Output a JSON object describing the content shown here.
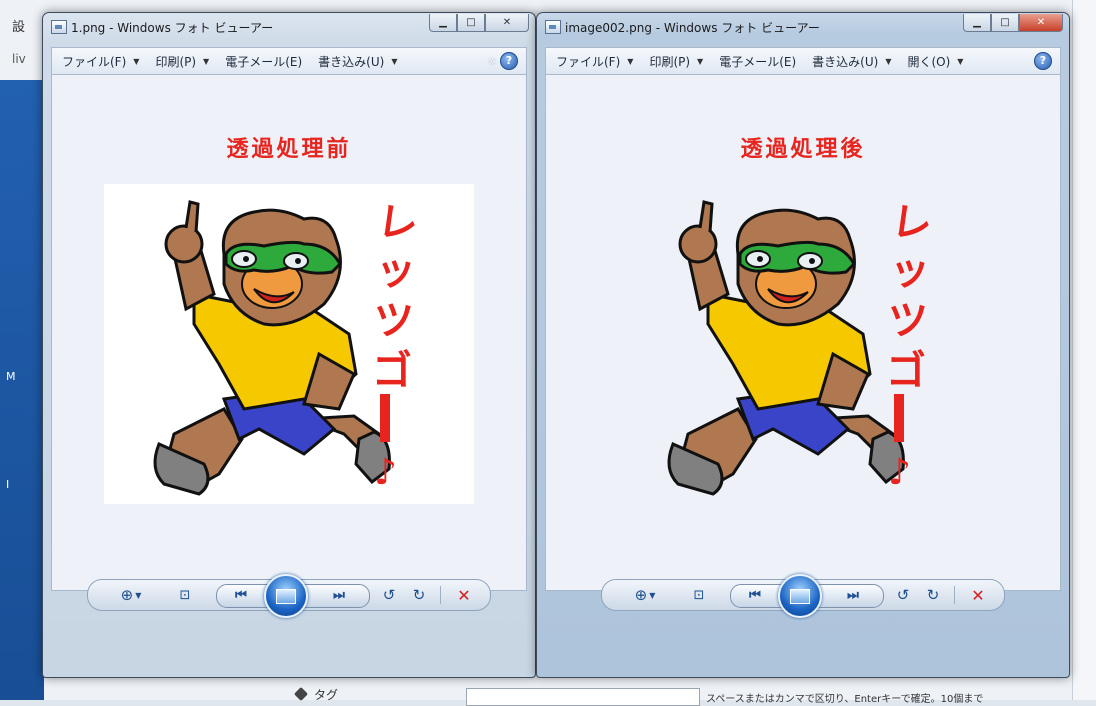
{
  "background": {
    "left_text_top": "設",
    "left_text_mid": "M",
    "left_text_low": "I",
    "address_fragment": "liv",
    "tag_label": "タグ",
    "hint_text": "スペースまたはカンマで区切り、Enterキーで確定。10個まで"
  },
  "windows": [
    {
      "title": "1.png - Windows フォト ビューアー",
      "menu": [
        {
          "label": "ファイル(F)",
          "has_arrow": true
        },
        {
          "label": "印刷(P)",
          "has_arrow": true
        },
        {
          "label": "電子メール(E)",
          "has_arrow": false
        },
        {
          "label": "書き込み(U)",
          "has_arrow": true
        }
      ],
      "more_glyph": "»",
      "help_glyph": "?",
      "heading": "透過処理前",
      "background": "white"
    },
    {
      "title": "image002.png - Windows フォト ビューアー",
      "menu": [
        {
          "label": "ファイル(F)",
          "has_arrow": true
        },
        {
          "label": "印刷(P)",
          "has_arrow": true
        },
        {
          "label": "電子メール(E)",
          "has_arrow": false
        },
        {
          "label": "書き込み(U)",
          "has_arrow": true
        },
        {
          "label": "開く(O)",
          "has_arrow": true
        }
      ],
      "help_glyph": "?",
      "heading": "透過処理後",
      "background": "transparent"
    }
  ],
  "image_caption": "レッツゴー♪",
  "colors": {
    "heading_red": "#e8241f",
    "delete_red": "#d42020",
    "accent_blue": "#1e4f8e"
  }
}
